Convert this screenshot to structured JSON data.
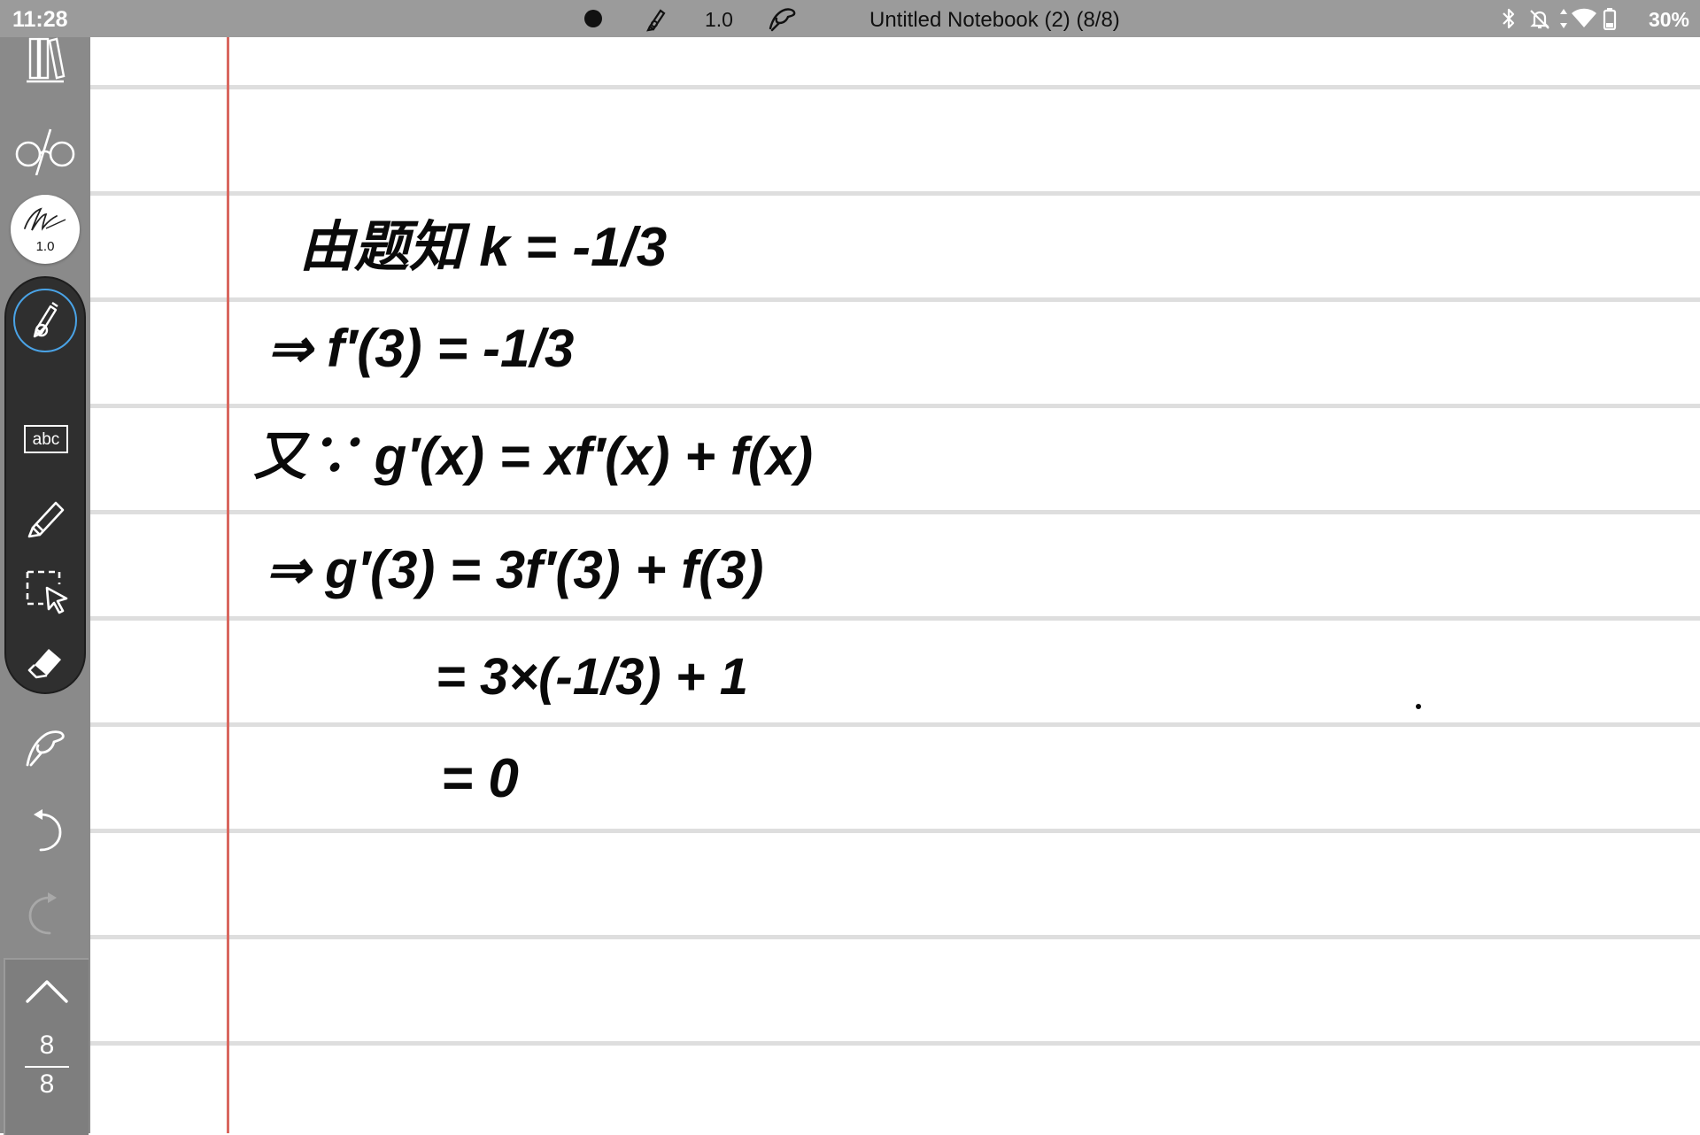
{
  "status_bar": {
    "time": "11:28",
    "pen_width": "1.0",
    "notebook_title": "Untitled Notebook (2) (8/8)",
    "battery": "30%",
    "icons": [
      "bluetooth-icon",
      "mute-icon",
      "data-arrows-icon",
      "wifi-icon",
      "battery-icon"
    ]
  },
  "toolbar": {
    "tools": [
      "library-icon",
      "glasses-icon",
      "pen-preset",
      "pen-tool",
      "text-tool",
      "highlighter-tool",
      "lasso-select-tool",
      "eraser-tool",
      "touch-gesture-tool",
      "undo",
      "redo",
      "page-up"
    ],
    "pen_preset_width": "1.0",
    "text_tool_label": "abc",
    "page_current": "8",
    "page_total": "8",
    "active_tool": "pen-tool",
    "active_color": "#4aa3e6"
  },
  "notebook": {
    "rule_color": "#dedede",
    "margin_color": "#d9675f",
    "handwriting": [
      "由题知 k = -1/3",
      "⇒ f′(3) = -1/3",
      "又∵ g′(x) = xf′(x) + f(x)",
      "⇒ g′(3) = 3f′(3) + f(3)",
      "= 3×(-1/3) + 1",
      "= 0"
    ]
  }
}
